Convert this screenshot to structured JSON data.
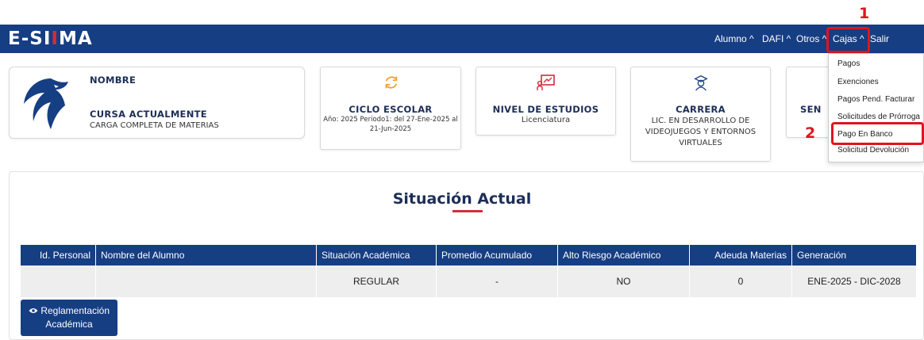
{
  "header": {
    "logo_prefix": "E-SI",
    "logo_accent": "I",
    "logo_suffix": "MA",
    "nav": [
      {
        "label": "Alumno ^"
      },
      {
        "label": "DAFI ^"
      },
      {
        "label": "Otros ^"
      },
      {
        "label": "Cajas ^"
      },
      {
        "label": "Salir"
      }
    ]
  },
  "annotations": {
    "step1": "1",
    "step2": "2"
  },
  "cajas_menu": {
    "items": [
      "Pagos",
      "Exenciones",
      "Pagos Pend. Facturar",
      "Solicitudes de Prórroga",
      "Pago En Banco",
      "Solicitud Devolución"
    ]
  },
  "student_card": {
    "nombre_label": "NOMBRE",
    "cursa_label": "CURSA ACTUALMENTE",
    "cursa_value": "CARGA COMPLETA DE MATERIAS"
  },
  "ciclo_card": {
    "title": "CICLO ESCOLAR",
    "line1": "Año: 2025 Periodo1: del 27-Ene-2025 al",
    "line2": "21-Jun-2025"
  },
  "nivel_card": {
    "title": "NIVEL DE ESTUDIOS",
    "value": "Licenciatura"
  },
  "carrera_card": {
    "title": "CARRERA",
    "line1": "LIC. EN DESARROLLO DE",
    "line2": "VIDEOJUEGOS Y ENTORNOS",
    "line3": "VIRTUALES"
  },
  "partial_card": {
    "title": "SEN"
  },
  "situacion": {
    "title": "Situación Actual",
    "columns": [
      "Id. Personal",
      "Nombre del Alumno",
      "Situación Académica",
      "Promedio Acumulado",
      "Alto Riesgo Académico",
      "Adeuda Materias",
      "Generación"
    ],
    "row": [
      "",
      "",
      "REGULAR",
      "-",
      "NO",
      "0",
      "ENE-2025 - DIC-2028"
    ]
  },
  "reglamento_button": {
    "line1": "Reglamentación",
    "line2": "Académica"
  },
  "colors": {
    "navbar": "#163e83",
    "accent": "#d62b3a",
    "annotation": "#e0141e"
  }
}
